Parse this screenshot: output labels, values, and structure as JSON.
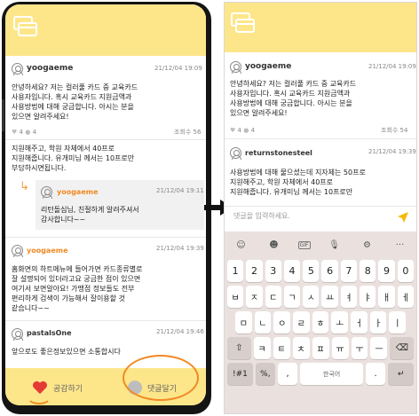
{
  "left": {
    "post": {
      "author": "yoogaeme",
      "time": "21/12/04 19:09",
      "body": [
        "안녕하세요? 저는 컬러풀 카드 중 교육카드",
        "사용자입니다. 혹시 교육카드 지원금액과",
        "사용방법에 대해 궁금합니다. 아시는 분을",
        "있으면 알려주세요!"
      ],
      "likes": "4",
      "comments": "4",
      "views": "조회수 56"
    },
    "partial_comment": [
      "지원해주고, 학원 자체에서 40프로",
      "지원해줍니다. 유개미님 께서는 10프로만",
      "부담하시면됩니다."
    ],
    "reply": {
      "author": "yoogaeme",
      "time": "21/12/04 19:11",
      "body": [
        "리턴돌심님, 친절하게 알려주셔서",
        "감사합니다~~"
      ]
    },
    "comment2": {
      "author": "yoogaeme",
      "time": "21/12/04 19:39",
      "body": [
        "홈화면의 하트메뉴에 들어가면 카드종류별로",
        "잘 설명되어 있더라고요 궁금한 점이 있으면",
        "여기서 보면알아요! 가맹점 정보들도 전부",
        "편리하게 검색이 가능해서 잘이용할 것",
        "같습니다~~"
      ]
    },
    "comment3": {
      "author": "pastalsOne",
      "time": "21/12/04 19:46",
      "body": [
        "앞으로도 좋은정보있으면 소통합시다"
      ]
    },
    "bottom": {
      "like_label": "공감하기",
      "comment_label": "댓글달기"
    }
  },
  "right": {
    "post": {
      "author": "yoogaeme",
      "time": "21/12/04 19:09",
      "body": [
        "안녕하세요? 저는 컬러풀 카드 중 교육카드",
        "사용자입니다. 혹시 교육카드 지원금액과",
        "사용방법에 대해 궁금합니다. 아시는 분을",
        "있으면 알려주세요!"
      ],
      "likes": "4",
      "comments": "4",
      "views": "조회수 54"
    },
    "comment": {
      "author": "returnstonesteel",
      "time": "21/12/04 19:39",
      "body": [
        "사용방법에 대해 물으셨는데 지자체는 50프로",
        "지원해주고, 학원 자체에서 40프로",
        "지원해줍니다. 유개미님 께서는 10프로만"
      ]
    },
    "input_placeholder": "댓글을 입력하세요.",
    "keyboard": {
      "toolbar": [
        "☺",
        "☻",
        "GIF",
        "🎙",
        "⚙",
        "···"
      ],
      "row_numbers": [
        "1",
        "2",
        "3",
        "4",
        "5",
        "6",
        "7",
        "8",
        "9",
        "0"
      ],
      "row1": [
        "ㅂ",
        "ㅈ",
        "ㄷ",
        "ㄱ",
        "ㅅ",
        "ㅛ",
        "ㅕ",
        "ㅑ",
        "ㅐ",
        "ㅔ"
      ],
      "row2": [
        "ㅁ",
        "ㄴ",
        "ㅇ",
        "ㄹ",
        "ㅎ",
        "ㅗ",
        "ㅓ",
        "ㅏ",
        "ㅣ"
      ],
      "row3": [
        "ㅋ",
        "ㅌ",
        "ㅊ",
        "ㅍ",
        "ㅠ",
        "ㅜ",
        "ㅡ"
      ],
      "shift": "⇧",
      "backspace": "⌫",
      "symbols": "!#1",
      "comma_sym": "%,",
      "comma": ",",
      "space": "한국어",
      "period": ".",
      "enter": "↵"
    }
  },
  "colors": {
    "topbar": "#fde68a",
    "accent": "#f08a24",
    "heart": "#e53935"
  }
}
